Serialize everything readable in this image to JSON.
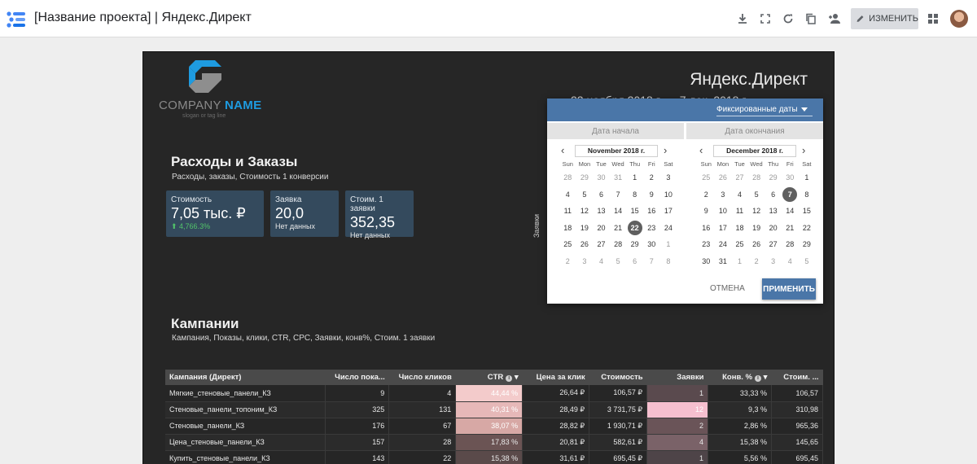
{
  "app": {
    "doc_title": "[Название проекта] | Яндекс.Директ",
    "edit_label": "ИЗМЕНИТЬ",
    "icons": [
      "download-icon",
      "fullscreen-icon",
      "refresh-icon",
      "copy-icon",
      "share-person-icon",
      "pencil-icon",
      "apps-grid-icon"
    ],
    "accent": "#4a76a8"
  },
  "report": {
    "company_name_a": "COMPANY ",
    "company_name_b": "NAME",
    "slogan": "slogan or tag line",
    "title": "Яндекс.Директ",
    "date_range_peek": "22 ноября 2018 г. — 7 дек. 2018 г.",
    "section1_title": "Расходы и Заказы",
    "section1_sub": "Расходы, заказы, Стоимость 1 конверсии",
    "axis_label": "Заявки",
    "kpis": [
      {
        "label": "Стоимость",
        "value": "7,05 тыс. ₽",
        "delta": "⬆ 4,766.3%"
      },
      {
        "label": "Заявка",
        "value": "20,0",
        "note": "Нет данных"
      },
      {
        "label": "Стоим. 1 заявки",
        "value": "352,35",
        "note": "Нет данных"
      }
    ],
    "section2_title": "Кампании",
    "section2_sub": "Кампания, Показы, клики, CTR, CPC, Заявки, конв%, Стоим. 1 заявки"
  },
  "table": {
    "headers": [
      "Кампания (Директ)",
      "Число пока...",
      "Число кликов",
      "CTR",
      "Цена за клик",
      "Стоимость",
      "Заявки",
      "Конв. %",
      "Стоим. ..."
    ],
    "rows": [
      [
        "Мягкие_стеновые_панели_КЗ",
        "9",
        "4",
        "44,44 %",
        "26,64 ₽",
        "106,57 ₽",
        "1",
        "33,33 %",
        "106,57"
      ],
      [
        "Стеновые_панели_топоним_КЗ",
        "325",
        "131",
        "40,31 %",
        "28,49 ₽",
        "3 731,75 ₽",
        "12",
        "9,3 %",
        "310,98"
      ],
      [
        "Стеновые_панели_КЗ",
        "176",
        "67",
        "38,07 %",
        "28,82 ₽",
        "1 930,71 ₽",
        "2",
        "2,86 %",
        "965,36"
      ],
      [
        "Цена_стеновые_панели_КЗ",
        "157",
        "28",
        "17,83 %",
        "20,81 ₽",
        "582,61 ₽",
        "4",
        "15,38 %",
        "145,65"
      ],
      [
        "Купить_стеновые_панели_КЗ",
        "143",
        "22",
        "15,38 %",
        "31,61 ₽",
        "695,45 ₽",
        "1",
        "5,56 %",
        "695,45"
      ]
    ],
    "ctr_heat_colors": [
      "#f3cbcb",
      "#e6b8b8",
      "#d7a8a5",
      "#6b5454",
      "#5a4a4a"
    ],
    "leads_heat_colors": [
      "#5a4a4e",
      "#f6bfcf",
      "#6a5458",
      "#7a6268",
      "#4e4448"
    ]
  },
  "picker": {
    "mode": "Фиксированные даты",
    "start_tab": "Дата начала",
    "end_tab": "Дата окончания",
    "cancel": "ОТМЕНА",
    "apply": "ПРИМЕНИТЬ",
    "dow": [
      "Sun",
      "Mon",
      "Tue",
      "Wed",
      "Thu",
      "Fri",
      "Sat"
    ],
    "left": {
      "month": "November 2018 г.",
      "selected": "22",
      "days": [
        [
          "28",
          "m"
        ],
        [
          "29",
          "m"
        ],
        [
          "30",
          "m"
        ],
        [
          "31",
          "m"
        ],
        [
          "1",
          ""
        ],
        [
          "2",
          ""
        ],
        [
          "3",
          ""
        ],
        [
          "4",
          ""
        ],
        [
          "5",
          ""
        ],
        [
          "6",
          ""
        ],
        [
          "7",
          ""
        ],
        [
          "8",
          ""
        ],
        [
          "9",
          ""
        ],
        [
          "10",
          ""
        ],
        [
          "11",
          ""
        ],
        [
          "12",
          ""
        ],
        [
          "13",
          ""
        ],
        [
          "14",
          ""
        ],
        [
          "15",
          ""
        ],
        [
          "16",
          ""
        ],
        [
          "17",
          ""
        ],
        [
          "18",
          ""
        ],
        [
          "19",
          ""
        ],
        [
          "20",
          ""
        ],
        [
          "21",
          ""
        ],
        [
          "22",
          ""
        ],
        [
          "23",
          ""
        ],
        [
          "24",
          ""
        ],
        [
          "25",
          ""
        ],
        [
          "26",
          ""
        ],
        [
          "27",
          ""
        ],
        [
          "28",
          ""
        ],
        [
          "29",
          ""
        ],
        [
          "30",
          ""
        ],
        [
          "1",
          "m"
        ],
        [
          "2",
          "m"
        ],
        [
          "3",
          "m"
        ],
        [
          "4",
          "m"
        ],
        [
          "5",
          "m"
        ],
        [
          "6",
          "m"
        ],
        [
          "7",
          "m"
        ],
        [
          "8",
          "m"
        ]
      ]
    },
    "right": {
      "month": "December 2018 г.",
      "selected": "7",
      "days": [
        [
          "25",
          "m"
        ],
        [
          "26",
          "m"
        ],
        [
          "27",
          "m"
        ],
        [
          "28",
          "m"
        ],
        [
          "29",
          "m"
        ],
        [
          "30",
          "m"
        ],
        [
          "1",
          ""
        ],
        [
          "2",
          ""
        ],
        [
          "3",
          ""
        ],
        [
          "4",
          ""
        ],
        [
          "5",
          ""
        ],
        [
          "6",
          ""
        ],
        [
          "7",
          ""
        ],
        [
          "8",
          ""
        ],
        [
          "9",
          ""
        ],
        [
          "10",
          ""
        ],
        [
          "11",
          ""
        ],
        [
          "12",
          ""
        ],
        [
          "13",
          ""
        ],
        [
          "14",
          ""
        ],
        [
          "15",
          ""
        ],
        [
          "16",
          ""
        ],
        [
          "17",
          ""
        ],
        [
          "18",
          ""
        ],
        [
          "19",
          ""
        ],
        [
          "20",
          ""
        ],
        [
          "21",
          ""
        ],
        [
          "22",
          ""
        ],
        [
          "23",
          ""
        ],
        [
          "24",
          ""
        ],
        [
          "25",
          ""
        ],
        [
          "26",
          ""
        ],
        [
          "27",
          ""
        ],
        [
          "28",
          ""
        ],
        [
          "29",
          ""
        ],
        [
          "30",
          ""
        ],
        [
          "31",
          ""
        ],
        [
          "1",
          "m"
        ],
        [
          "2",
          "m"
        ],
        [
          "3",
          "m"
        ],
        [
          "4",
          "m"
        ],
        [
          "5",
          "m"
        ]
      ]
    }
  }
}
